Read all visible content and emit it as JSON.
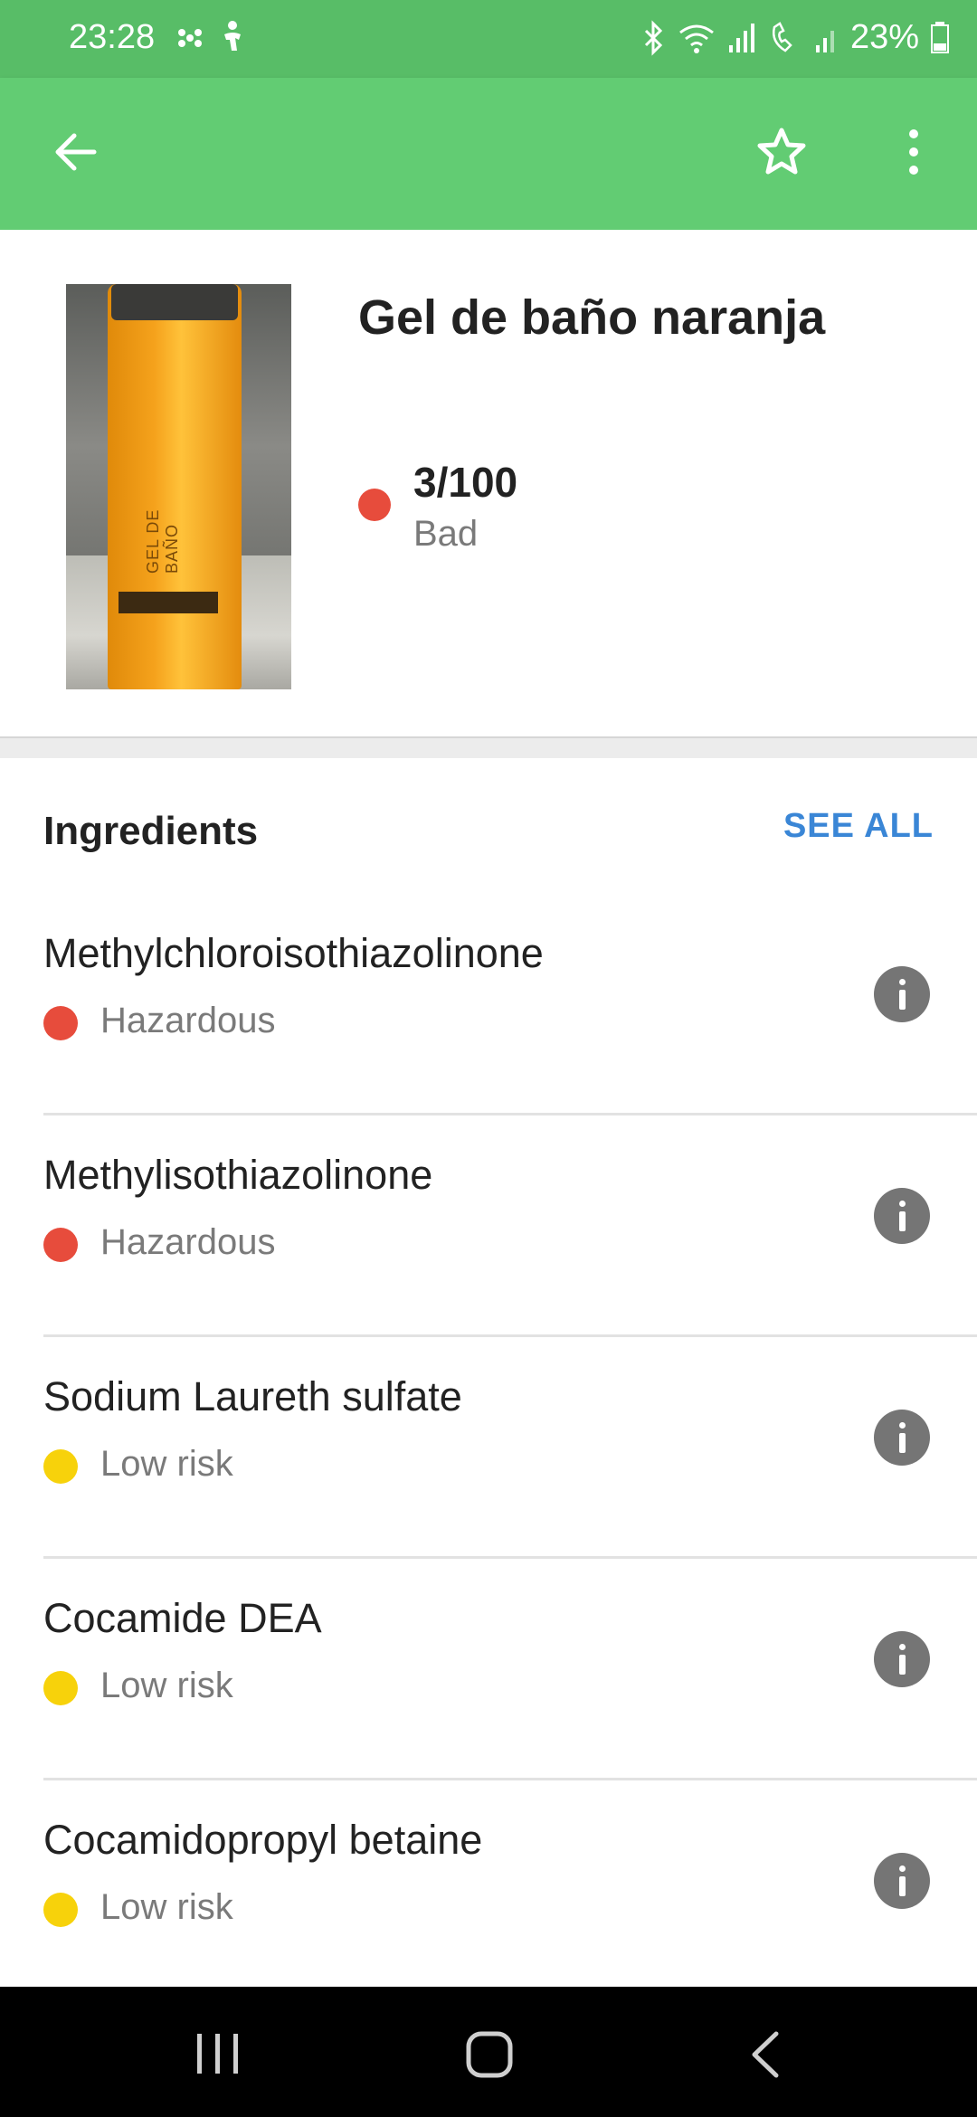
{
  "status_bar": {
    "time": "23:28",
    "battery_percent": "23%",
    "icons": [
      "dots-icon",
      "accessibility-icon",
      "bluetooth-icon",
      "wifi-icon",
      "signal-icon",
      "wifi-calling-icon",
      "signal-2-icon",
      "battery-icon"
    ]
  },
  "app_bar": {
    "back_icon": "arrow-left-icon",
    "favorite_icon": "star-outline-icon",
    "menu_icon": "more-vertical-icon",
    "color": "#62cc73"
  },
  "product": {
    "title": "Gel de baño naranja",
    "image_label_text": "GEL DE BAÑO",
    "score": "3/100",
    "rating": "Bad",
    "rating_color": "#e74c3c"
  },
  "ingredients": {
    "title": "Ingredients",
    "see_all_label": "SEE ALL",
    "items": [
      {
        "name": "Methylchloroisothiazolinone",
        "risk": "Hazardous",
        "color": "#e74c3c"
      },
      {
        "name": "Methylisothiazolinone",
        "risk": "Hazardous",
        "color": "#e74c3c"
      },
      {
        "name": "Sodium Laureth sulfate",
        "risk": "Low risk",
        "color": "#f7d20b"
      },
      {
        "name": "Cocamide DEA",
        "risk": "Low risk",
        "color": "#f7d20b"
      },
      {
        "name": "Cocamidopropyl betaine",
        "risk": "Low risk",
        "color": "#f7d20b"
      }
    ]
  },
  "nav_bar": {
    "recents_icon": "recents-icon",
    "home_icon": "home-icon",
    "back_icon": "nav-back-icon"
  }
}
